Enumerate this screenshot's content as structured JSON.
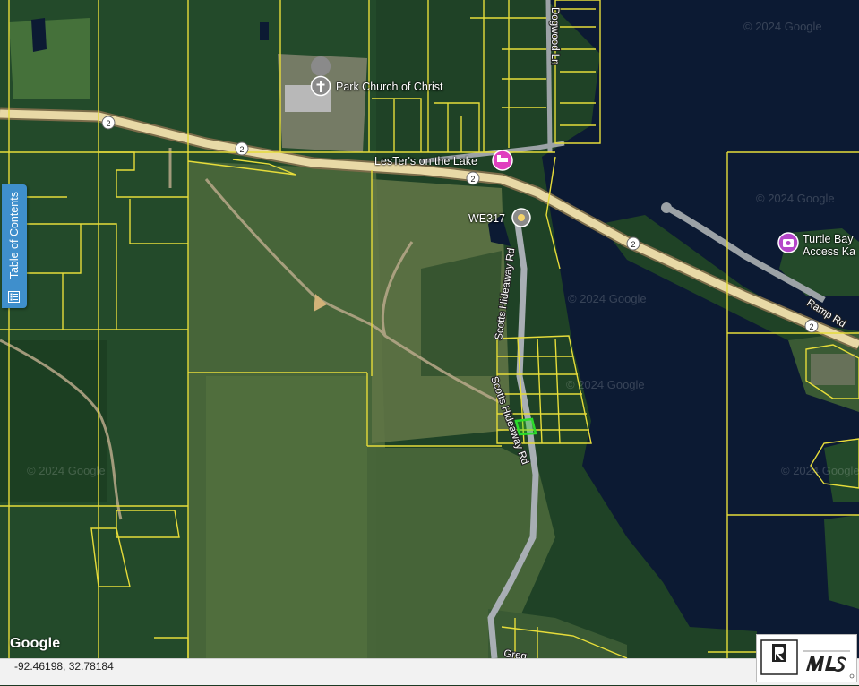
{
  "map": {
    "copyright_marks": [
      "© 2024 Google",
      "© 2024 Google",
      "© 2024 Google",
      "© 2024 Google",
      "© 2024 Google",
      "© 2024 Google"
    ],
    "attribution": "Google",
    "pois": [
      {
        "name": "Park Church of Christ",
        "icon": "church-icon",
        "color": "#8a8a8a"
      },
      {
        "name": "LesTer's on the Lake",
        "icon": "hotel-icon",
        "color": "#e03fbf"
      },
      {
        "name": "WE317",
        "icon": "pin-icon",
        "color": "#8a8a8a"
      },
      {
        "name": "Turtle Bay Access Ka",
        "icon": "camera-icon",
        "color": "#b546c9"
      }
    ],
    "roads": [
      "Dogwood Ln",
      "Scotts Hideaway Rd",
      "Scotts Hideaway Rd",
      "Ramp Rd",
      "Greg"
    ],
    "route_shields": [
      "2",
      "2",
      "2",
      "2",
      "2"
    ],
    "parcel_color": "#e6dc3a",
    "selected_parcel_color": "#2bdc2b",
    "water_color": "#0c1a33"
  },
  "toc": {
    "label": "Table of Contents",
    "icon": "list-icon"
  },
  "status": {
    "coordinates": "-92.46198, 32.78184"
  },
  "logo": {
    "name": "REALTOR MLS",
    "icon": "realtor-mls-logo"
  }
}
